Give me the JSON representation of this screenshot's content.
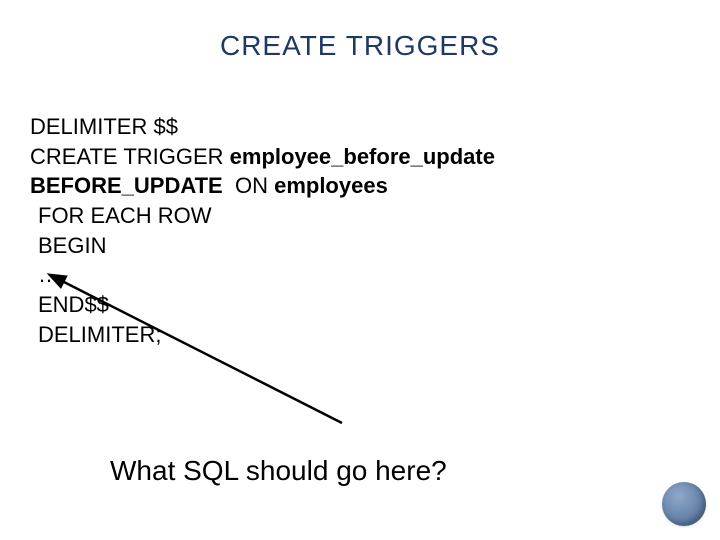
{
  "title": "CREATE TRIGGERS",
  "code": {
    "l1": "DELIMITER $$",
    "l2a": "CREATE TRIGGER ",
    "l2b": "employee_before_update",
    "l3a": "BEFORE_UPDATE",
    "l3b": "  ON ",
    "l3c": "employees",
    "l4": "FOR EACH ROW",
    "l5": "BEGIN",
    "l6": "…",
    "l7": "END$$",
    "l8": "DELIMITER;"
  },
  "question": "What SQL should go here?"
}
